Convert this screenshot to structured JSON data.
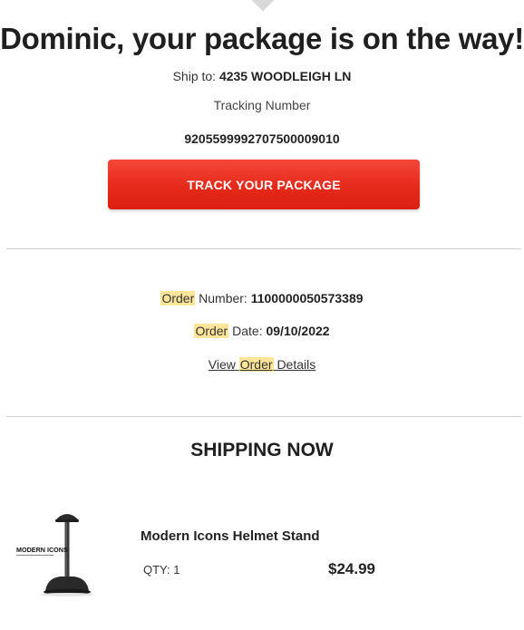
{
  "shipping_email": {
    "headline": "Dominic, your package is on the way!",
    "ship_to_label": "Ship to:",
    "ship_to_address": "4235 WOODLEIGH LN",
    "tracking_label": "Tracking Number",
    "tracking_number": "9205599992707500009010",
    "track_button_label": "TRACK YOUR PACKAGE"
  },
  "order": {
    "highlight_word": "Order",
    "number_label": "Number:",
    "number_value": "1100000050573389",
    "date_label": "Date:",
    "date_value": "09/10/2022",
    "view_prefix": "View",
    "view_suffix": "Details"
  },
  "shipping_now": {
    "title": "SHIPPING NOW",
    "item": {
      "name": "Modern Icons Helmet Stand",
      "qty": "QTY: 1",
      "price": "$24.99",
      "image_brand_text": "MODERN ICONS"
    }
  },
  "colors": {
    "button_red": "#e52a1a",
    "search_highlight": "#ffe599"
  }
}
